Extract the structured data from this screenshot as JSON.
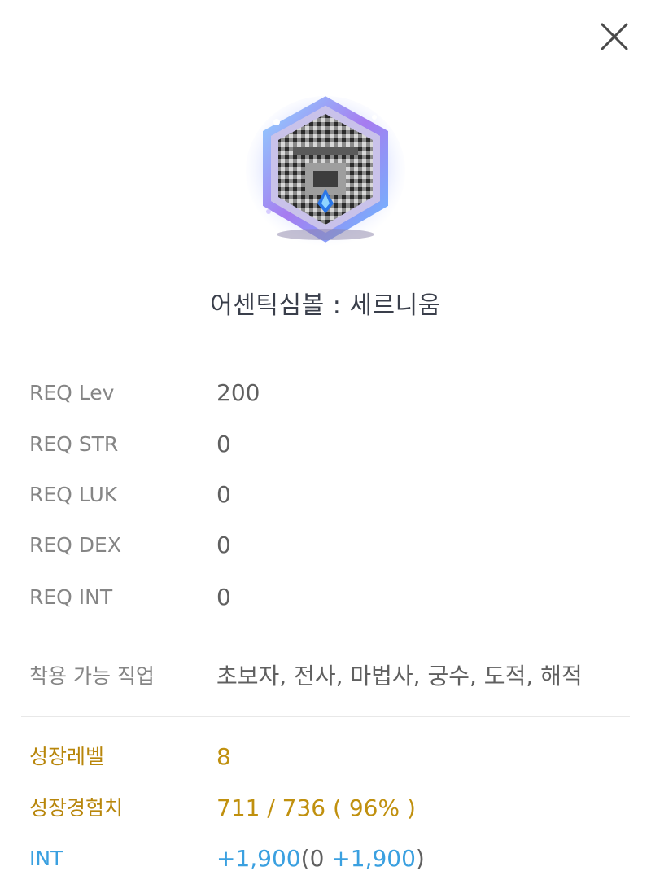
{
  "item": {
    "name": "어센틱심볼 : 세르니움",
    "icon": "authentic-symbol-cernium-icon"
  },
  "requirements": [
    {
      "label": "REQ Lev",
      "value": "200"
    },
    {
      "label": "REQ STR",
      "value": "0"
    },
    {
      "label": "REQ LUK",
      "value": "0"
    },
    {
      "label": "REQ DEX",
      "value": "0"
    },
    {
      "label": "REQ INT",
      "value": "0"
    }
  ],
  "jobs": {
    "label": "착용 가능 직업",
    "value": "초보자, 전사, 마법사, 궁수, 도적, 해적"
  },
  "growth": {
    "level_label": "성장레벨",
    "level_value": "8",
    "exp_label": "성장경험치",
    "exp_value": "711 / 736 ( 96% )"
  },
  "stat": {
    "label": "INT",
    "total": "+1,900",
    "open_paren": "(",
    "base": "0",
    "bonus": "+1,900",
    "close_paren": ")"
  },
  "colors": {
    "growth_text": "#c0900e",
    "stat_text": "#3aa0e0"
  }
}
